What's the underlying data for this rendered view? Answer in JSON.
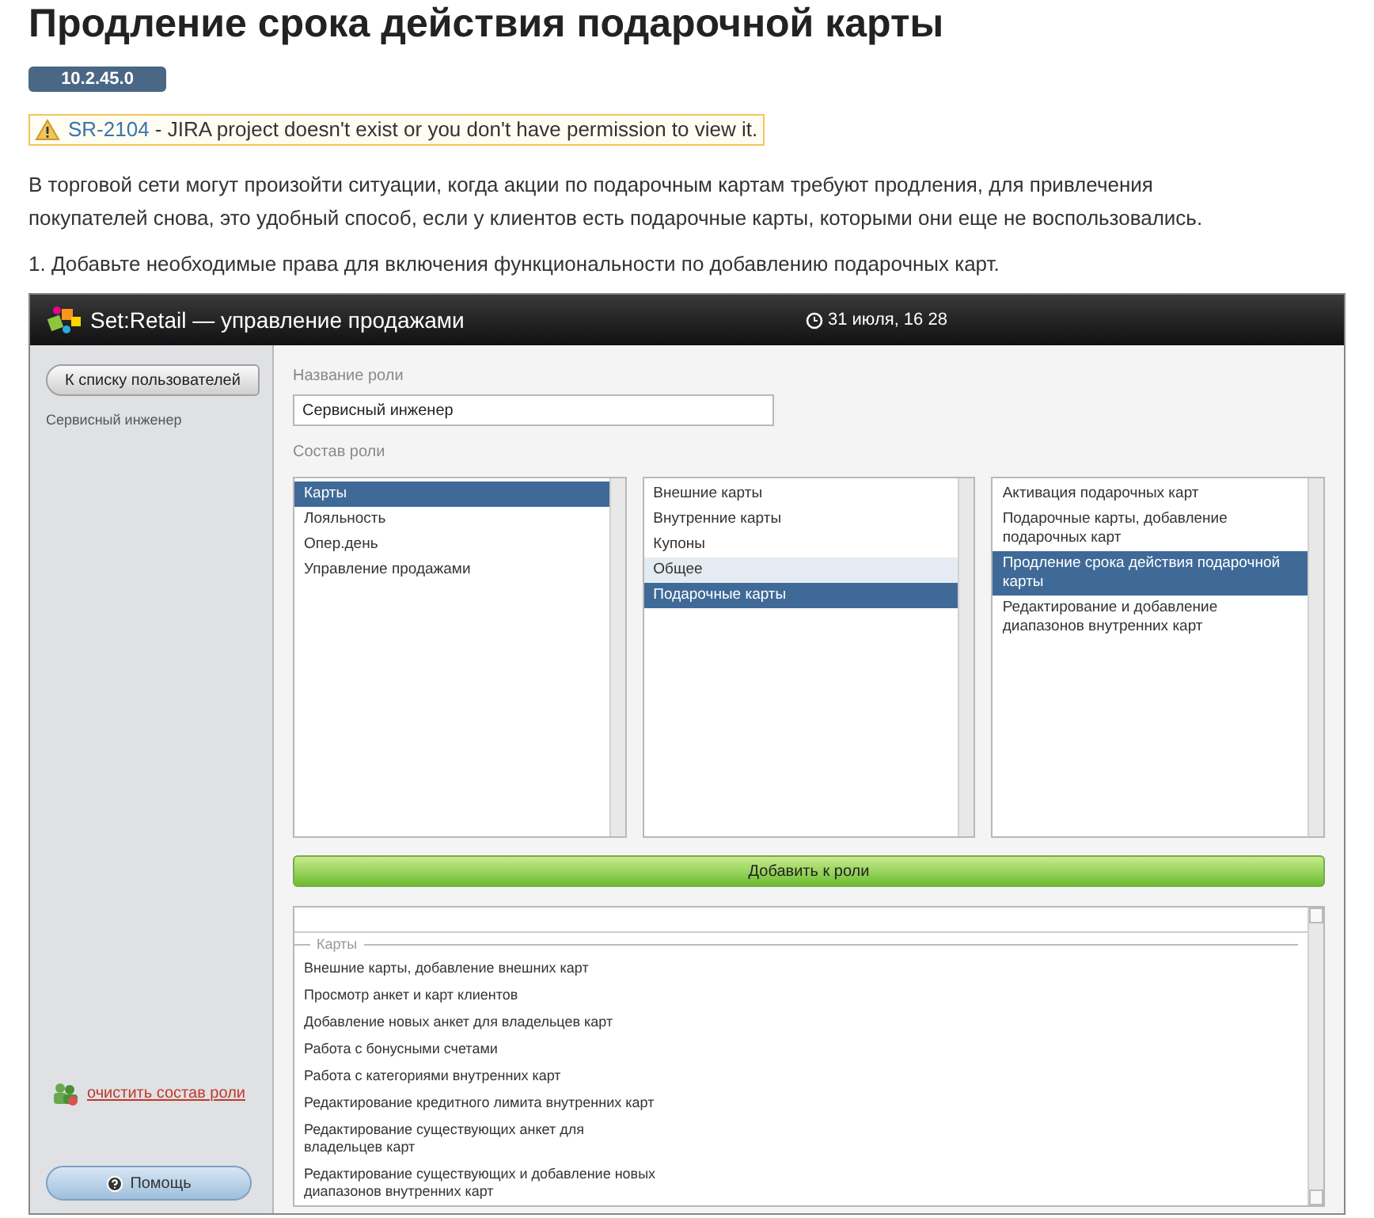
{
  "page": {
    "title": "Продление срока действия подарочной карты",
    "version_badge": "10.2.45.0",
    "jira_warning": {
      "issue": "SR-2104",
      "message": " - JIRA project doesn't exist or you don't have permission to view it."
    },
    "intro": "В торговой сети могут произойти ситуации, когда акции по подарочным картам требуют продления, для привлечения покупателей снова, это удобный способ, если у клиентов есть подарочные карты, которыми они еще не воспользовались.",
    "step": "1. Добавьте необходимые права для включения функциональности по добавлению подарочных карт."
  },
  "app": {
    "title": "Set:Retail — управление продажами",
    "datetime": "31 июля, 16 28",
    "sidebar": {
      "back_button": "К списку пользователей",
      "role_name": "Сервисный инженер",
      "clear_link": "очистить состав роли",
      "help_button": "Помощь"
    },
    "role_name_label": "Название роли",
    "role_name_value": "Сервисный инженер",
    "role_contents_label": "Состав роли",
    "lists": [
      [
        {
          "label": "Карты",
          "selected": true,
          "highlighted": false
        },
        {
          "label": "Лояльность",
          "selected": false,
          "highlighted": false
        },
        {
          "label": "Опер.день",
          "selected": false,
          "highlighted": false
        },
        {
          "label": "Управление продажами",
          "selected": false,
          "highlighted": false
        }
      ],
      [
        {
          "label": "Внешние карты",
          "selected": false,
          "highlighted": false
        },
        {
          "label": "Внутренние карты",
          "selected": false,
          "highlighted": false
        },
        {
          "label": "Купоны",
          "selected": false,
          "highlighted": false
        },
        {
          "label": "Общее",
          "selected": false,
          "highlighted": true
        },
        {
          "label": "Подарочные карты",
          "selected": true,
          "highlighted": false
        }
      ],
      [
        {
          "label": "Активация подарочных карт",
          "selected": false,
          "highlighted": false
        },
        {
          "label": "Подарочные карты, добавление подарочных карт",
          "selected": false,
          "highlighted": false
        },
        {
          "label": "Продление срока действия подарочной карты",
          "selected": true,
          "highlighted": false
        },
        {
          "label": "Редактирование и добавление диапазонов внутренних карт",
          "selected": false,
          "highlighted": false
        }
      ]
    ],
    "add_button": "Добавить к роли",
    "permissions": {
      "group": "Карты",
      "items": [
        "Внешние карты, добавление внешних карт",
        "Просмотр анкет и карт клиентов",
        "Добавление новых анкет для владельцев карт",
        "Работа с бонусными счетами",
        "Работа с категориями внутренних карт",
        "Редактирование кредитного лимита внутренних карт",
        "Редактирование существующих анкет для владельцев карт",
        "Редактирование существующих и добавление новых диапазонов внутренних карт"
      ]
    }
  }
}
